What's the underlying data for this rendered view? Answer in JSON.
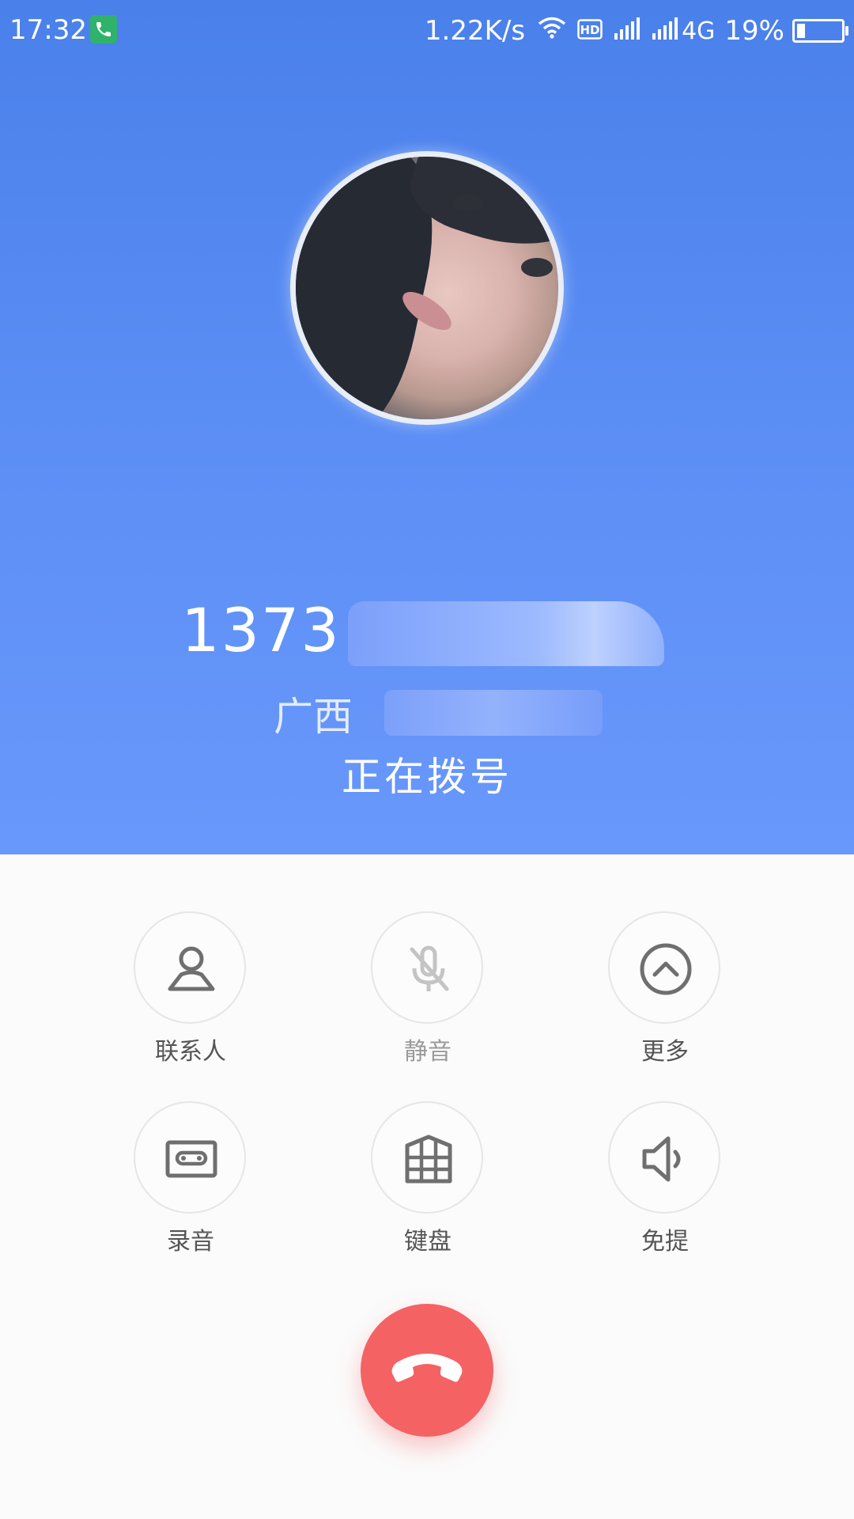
{
  "status_bar": {
    "time": "17:32",
    "net_speed": "1.22K/s",
    "network_type": "4G",
    "battery_percent": "19%",
    "battery_level": 0.19,
    "icons": [
      "call-active-icon",
      "wifi-icon",
      "hd-icon",
      "signal-icon",
      "signal-icon"
    ]
  },
  "caller": {
    "number_visible": "1373",
    "location_visible": "广西",
    "call_status": "正在拨号"
  },
  "controls": [
    {
      "label": "联系人",
      "icon": "person-icon",
      "enabled": true
    },
    {
      "label": "静音",
      "icon": "mic-off-icon",
      "enabled": false
    },
    {
      "label": "更多",
      "icon": "chevron-up-circle-icon",
      "enabled": true
    },
    {
      "label": "录音",
      "icon": "cassette-icon",
      "enabled": true
    },
    {
      "label": "键盘",
      "icon": "keypad-icon",
      "enabled": true
    },
    {
      "label": "免提",
      "icon": "speaker-icon",
      "enabled": true
    }
  ],
  "end_call": {
    "icon": "end-call-icon"
  },
  "colors": {
    "header_top": "#4a80ea",
    "header_bottom": "#6998fb",
    "end_call": "#f46264",
    "icon": "#6f6f6f",
    "icon_disabled": "#c4c4c4",
    "call_badge": "#2fb36b"
  }
}
